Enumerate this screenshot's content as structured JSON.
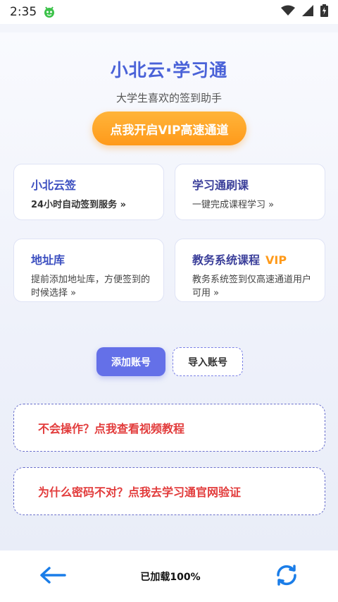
{
  "status_bar": {
    "time": "2:35"
  },
  "header": {
    "title": "小北云·学习通",
    "subtitle": "大学生喜欢的签到助手",
    "vip_button": "点我开启VIP高速通道"
  },
  "cards": [
    {
      "title": "小北云签",
      "desc": "24小时自动签到服务 »"
    },
    {
      "title": "学习通刷课",
      "desc": "一键完成课程学习 »"
    },
    {
      "title": "地址库",
      "desc": "提前添加地址库，方便签到的时候选择 »"
    },
    {
      "title": "教务系统课程",
      "tag": "VIP",
      "desc": "教务系统签到仅高速通道用户可用 »"
    }
  ],
  "actions": {
    "add_account": "添加账号",
    "import_account": "导入账号"
  },
  "notices": {
    "video_tutorial": "不会操作？点我查看视频教程",
    "password_verify": "为什么密码不对？点我去学习通官网验证"
  },
  "bottom_bar": {
    "load_status": "已加载100%"
  },
  "colors": {
    "primary": "#4a62d8",
    "accent_orange": "#ff9a1a",
    "button_purple": "#6470e8",
    "warning_red": "#e23c3c"
  }
}
